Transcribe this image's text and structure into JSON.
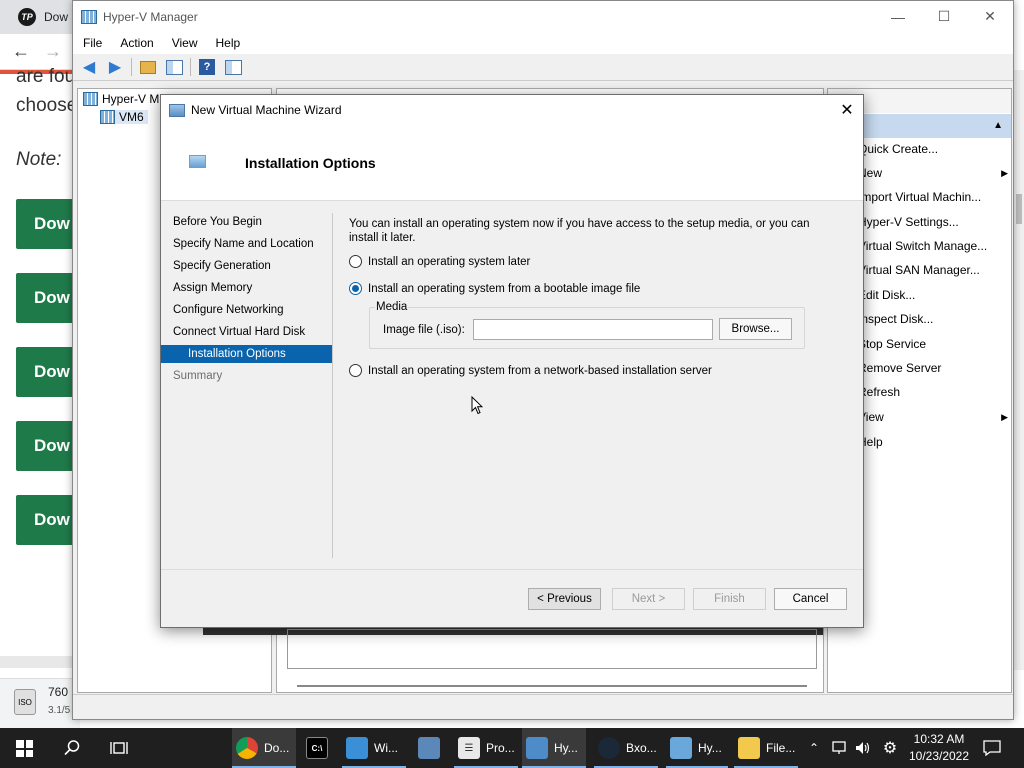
{
  "bg_browser": {
    "tab_text": "Dow",
    "text_lines": [
      "are fou",
      "choose"
    ],
    "note": "Note:",
    "download_buttons": [
      "Dow",
      "Dow",
      "Dow",
      "Dow",
      "Dow"
    ],
    "download_file_name": "760",
    "download_file_size": "3.1/5"
  },
  "hyperv": {
    "title": "Hyper-V Manager",
    "menu": [
      "File",
      "Action",
      "View",
      "Help"
    ],
    "tree": {
      "root": "Hyper-V M",
      "child": "VM6"
    },
    "actions_header": "ns",
    "actions": [
      "Quick Create...",
      "New",
      "Import Virtual Machin...",
      "Hyper-V Settings...",
      "Virtual Switch Manage...",
      "Virtual SAN Manager...",
      "Edit Disk...",
      "Inspect Disk...",
      "Stop Service",
      "Remove Server",
      "Refresh",
      "View",
      "Help"
    ]
  },
  "wizard": {
    "title": "New Virtual Machine Wizard",
    "header": "Installation Options",
    "steps": [
      "Before You Begin",
      "Specify Name and Location",
      "Specify Generation",
      "Assign Memory",
      "Configure Networking",
      "Connect Virtual Hard Disk",
      "Installation Options",
      "Summary"
    ],
    "current_step": "Installation Options",
    "description": "You can install an operating system now if you have access to the setup media, or you can install it later.",
    "option_later": "Install an operating system later",
    "option_image": "Install an operating system from a bootable image file",
    "media_label": "Media",
    "iso_label": "Image file (.iso):",
    "iso_value": "",
    "browse_label": "Browse...",
    "option_network": "Install an operating system from a network-based installation server",
    "buttons": {
      "previous": "< Previous",
      "next": "Next >",
      "finish": "Finish",
      "cancel": "Cancel"
    }
  },
  "taskbar": {
    "items": [
      "Do...",
      "Wi...",
      "Pro...",
      "Hy...",
      "Bxo...",
      "Hy...",
      "File..."
    ],
    "time": "10:32 AM",
    "date": "10/23/2022"
  }
}
